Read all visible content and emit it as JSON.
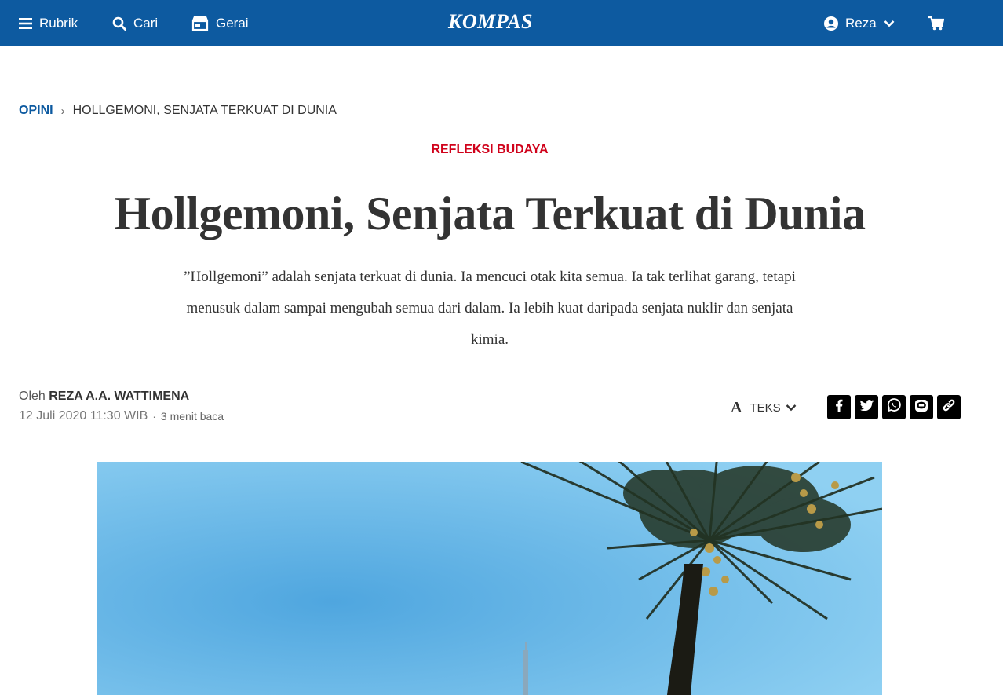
{
  "nav": {
    "rubrik_label": "Rubrik",
    "search_label": "Cari",
    "store_label": "Gerai",
    "logo": "KOMPAS",
    "user_name": "Reza"
  },
  "breadcrumb": {
    "section": "OPINI",
    "separator": "›",
    "current": "HOLLGEMONI, SENJATA TERKUAT DI DUNIA"
  },
  "article": {
    "kicker": "REFLEKSI BUDAYA",
    "title": "Hollgemoni, Senjata Terkuat di Dunia",
    "summary": "”Hollgemoni” adalah senjata terkuat di dunia. Ia mencuci otak kita semua. Ia tak terlihat garang, tetapi menusuk dalam sampai mengubah semua dari dalam. Ia lebih kuat daripada senjata nuklir dan senjata kimia.",
    "byline_prefix": "Oleh",
    "author": "REZA A.A. WATTIMENA",
    "date": "12 Juli 2020 11:30 WIB",
    "dot": "·",
    "read_time": "3 menit baca"
  },
  "toolbar": {
    "text_size_icon_letter": "A",
    "text_size_label": "TEKS"
  },
  "share_icons": [
    "facebook-icon",
    "twitter-icon",
    "whatsapp-icon",
    "line-icon",
    "link-icon"
  ],
  "colors": {
    "brand_blue": "#0d5aa0",
    "kicker_red": "#d0021b",
    "text_dark": "#333333",
    "share_bg": "#000000"
  }
}
